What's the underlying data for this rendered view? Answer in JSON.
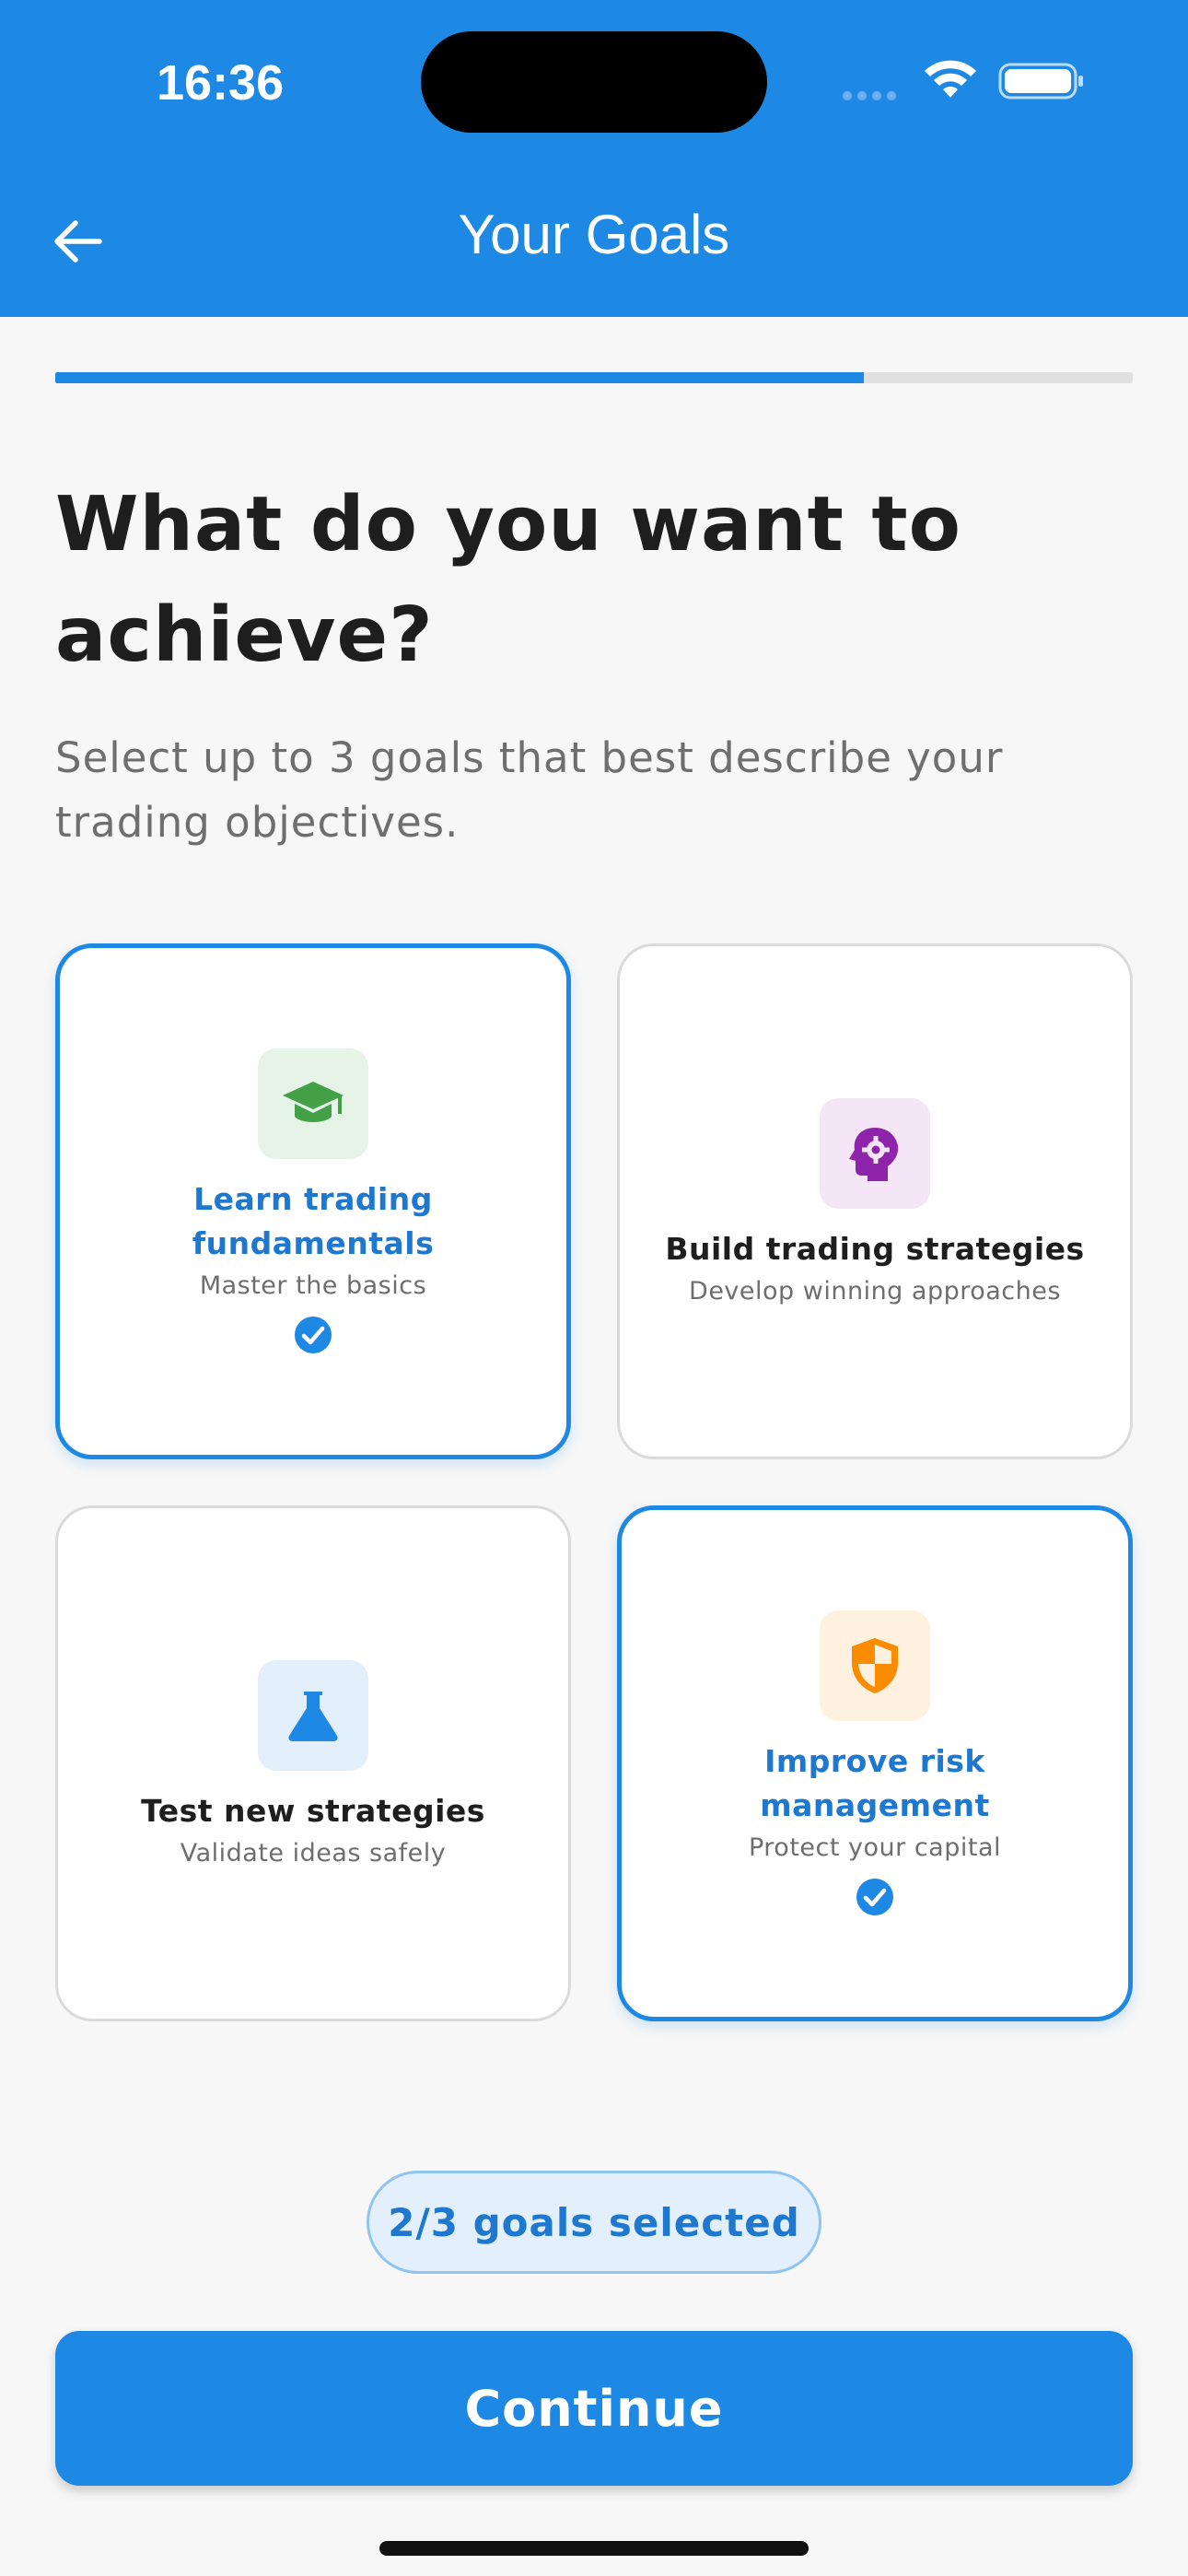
{
  "status_bar": {
    "time": "16:36"
  },
  "header": {
    "title": "Your Goals",
    "back_icon": "arrow-left-icon"
  },
  "progress": {
    "fraction": 0.75
  },
  "main": {
    "heading": "What do you want to achieve?",
    "subtext": "Select up to 3 goals that best describe your trading objectives."
  },
  "goals": [
    {
      "title": "Learn trading fundamentals",
      "desc": "Master the basics",
      "icon": "graduation-cap-icon",
      "selected": true,
      "icon_color": "#43A047",
      "icon_bg": "#E6F4E7"
    },
    {
      "title": "Build trading strategies",
      "desc": "Develop winning approaches",
      "icon": "brain-gear-icon",
      "selected": false,
      "icon_color": "#8E24AA",
      "icon_bg": "#F4E6F6"
    },
    {
      "title": "Test new strategies",
      "desc": "Validate ideas safely",
      "icon": "flask-icon",
      "selected": false,
      "icon_color": "#1E88E5",
      "icon_bg": "#E3F0FC"
    },
    {
      "title": "Improve risk management",
      "desc": "Protect your capital",
      "icon": "shield-icon",
      "selected": true,
      "icon_color": "#FB8C00",
      "icon_bg": "#FFF1DF"
    }
  ],
  "selection": {
    "count_label": "2/3 goals selected"
  },
  "footer": {
    "continue_label": "Continue"
  },
  "colors": {
    "primary": "#1E88E5",
    "selected_text": "#1E78D0"
  }
}
